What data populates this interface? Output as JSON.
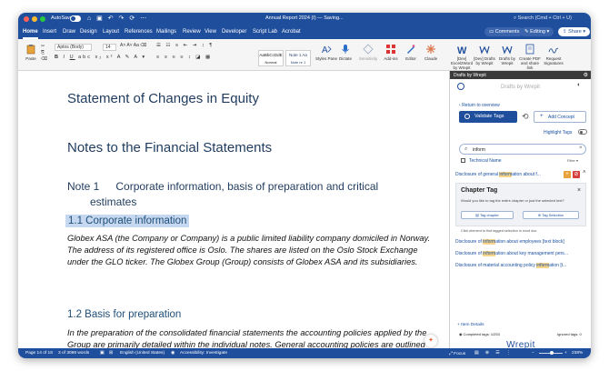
{
  "titlebar": {
    "autosave_label": "AutoSave",
    "doc_title": "Annual Report 2024 (I) — Saving...",
    "search_placeholder": "Search (Cmd + Ctrl + U)"
  },
  "menu": {
    "items": [
      "Home",
      "Insert",
      "Draw",
      "Design",
      "Layout",
      "References",
      "Mailings",
      "Review",
      "View",
      "Developer",
      "Script Lab",
      "Acrobat"
    ],
    "comments_label": "Comments",
    "editing_label": "Editing",
    "share_label": "Share"
  },
  "ribbon": {
    "paste_label": "Paste",
    "font_name": "Aptos (Body)",
    "font_size": "14",
    "styles": [
      {
        "preview": "AaBbCcDdE",
        "name": "Normal"
      },
      {
        "preview": "Note 1  Aa",
        "name": "Note nr 1"
      }
    ],
    "styles_pane_label": "Styles Pane",
    "dictate_label": "Dictate",
    "sensitivity_label": "Sensitivity",
    "addins_label": "Add-ins",
    "editor_label": "Editor",
    "claude_label": "Claude",
    "addin_buttons": [
      {
        "label": "[Dev] Excel2Word by Wrepit"
      },
      {
        "label": "[Dev] Drafts by Wrepit"
      },
      {
        "label": "Drafts by Wrepit"
      },
      {
        "label": "Create PDF and share link"
      },
      {
        "label": "Request Signatures"
      }
    ]
  },
  "document": {
    "heading_statement": "Statement of Changes in Equity",
    "heading_notes": "Notes to the Financial Statements",
    "note1_number": "Note 1",
    "note1_title_line1": "Corporate information, basis of preparation and critical",
    "note1_title_line2": "estimates",
    "section_1_1": "1.1 Corporate information",
    "para_1_1": "Globex ASA (the Company or Company) is a public limited liability company domiciled in Norway. The address of its registered office is Oslo. The shares are listed on the Oslo Stock Exchange under the GLO ticker. The Globex Group (Group) consists of Globex ASA and its subsidiaries.",
    "section_1_2": "1.2 Basis for preparation",
    "para_1_2": "In the preparation of the consolidated financial statements the accounting policies applied by the Group are primarily detailed within the individual notes. General accounting policies are outlined below. These policies have been consistently applied"
  },
  "panel": {
    "header": "Drafts by Wrepit",
    "title": "Drafts by Wrepit",
    "return_link": "Return to overview",
    "validate_label": "Validate Tags",
    "add_concept_label": "Add Concept",
    "highlight_tags_label": "Highlight Tags",
    "search_value": "inform",
    "technical_name_label": "Technical Name",
    "filter_label": "Filter",
    "first_result": {
      "pre": "Disclosure of general ",
      "hl": "inform",
      "post": "ation about f..."
    },
    "chapter_tag": {
      "title": "Chapter Tag",
      "description": "Would you like to tag the entire chapter or just the selected text?",
      "tag_chapter_label": "Tag chapter",
      "tag_selection_label": "Tag Selection"
    },
    "hint": "Click element to find tagged selection in word doc",
    "results": [
      {
        "pre": "Disclosure of ",
        "hl": "inform",
        "post": "ation about employees [text block]"
      },
      {
        "pre": "Disclosure of ",
        "hl": "inform",
        "post": "ation about key management pers..."
      },
      {
        "pre": "Disclosure of material accounting policy ",
        "hl": "inform",
        "post": "ation [t..."
      }
    ],
    "item_details_label": "Item Details",
    "completed_tags": "Completed tags: 1/253",
    "ignored_tags": "Ignored tags: 0",
    "logo_text": "Wrepit"
  },
  "statusbar": {
    "page": "Page 14 of 18",
    "words": "3 of 3098 words",
    "language": "English (United States)",
    "accessibility": "Accessibility: Investigate",
    "focus_label": "Focus",
    "zoom": "238%"
  },
  "colors": {
    "brand_blue": "#1f4e9c",
    "highlight": "#f7d58a",
    "selection": "#c5d8ef",
    "link": "#1a4fa0"
  }
}
